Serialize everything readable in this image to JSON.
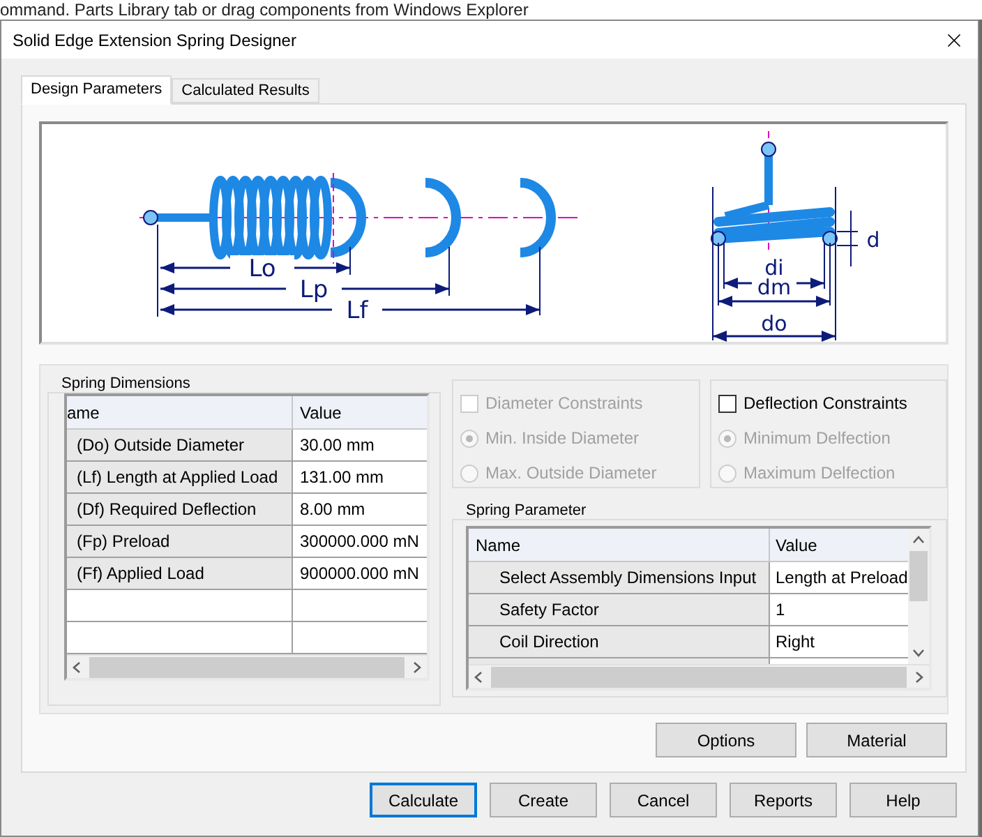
{
  "background_text": "ommand. Parts Library tab or drag components from Windows Explorer",
  "window": {
    "title": "Solid Edge Extension Spring Designer"
  },
  "tabs": [
    {
      "label": "Design Parameters",
      "selected": true
    },
    {
      "label": "Calculated Results",
      "selected": false
    }
  ],
  "diagram": {
    "labels": [
      "Lo",
      "Lp",
      "Lf",
      "di",
      "dm",
      "do",
      "d"
    ]
  },
  "spring_dimensions": {
    "title": "Spring Dimensions",
    "columns": [
      "ame",
      "Value"
    ],
    "rows": [
      {
        "name": "(Do) Outside Diameter",
        "value": "30.00 mm"
      },
      {
        "name": "(Lf) Length at Applied Load",
        "value": "131.00 mm"
      },
      {
        "name": "(Df) Required Deflection",
        "value": "8.00 mm"
      },
      {
        "name": "(Fp) Preload",
        "value": "300000.000 mN"
      },
      {
        "name": "(Ff) Applied Load",
        "value": "900000.000 mN"
      }
    ]
  },
  "constraint_groups": [
    {
      "label": "Diameter Constraints",
      "checked": false,
      "disabled": true,
      "options": [
        {
          "label": "Min. Inside Diameter",
          "selected": true
        },
        {
          "label": "Max. Outside Diameter",
          "selected": false
        }
      ]
    },
    {
      "label": "Deflection Constraints",
      "checked": false,
      "disabled": false,
      "options": [
        {
          "label": "Minimum Delfection",
          "selected": true
        },
        {
          "label": "Maximum Delfection",
          "selected": false
        }
      ]
    }
  ],
  "spring_parameter": {
    "title": "Spring Parameter",
    "columns": [
      "Name",
      "Value"
    ],
    "rows": [
      {
        "name": "Select Assembly Dimensions Input",
        "value": "Length at Preload"
      },
      {
        "name": "Safety Factor",
        "value": "1"
      },
      {
        "name": "Coil Direction",
        "value": "Right"
      }
    ]
  },
  "panel_buttons": [
    "Options",
    "Material"
  ],
  "buttons": [
    {
      "label": "Calculate",
      "default": true
    },
    {
      "label": "Create",
      "default": false
    },
    {
      "label": "Cancel",
      "default": false
    },
    {
      "label": "Reports",
      "default": false
    },
    {
      "label": "Help",
      "default": false
    }
  ]
}
